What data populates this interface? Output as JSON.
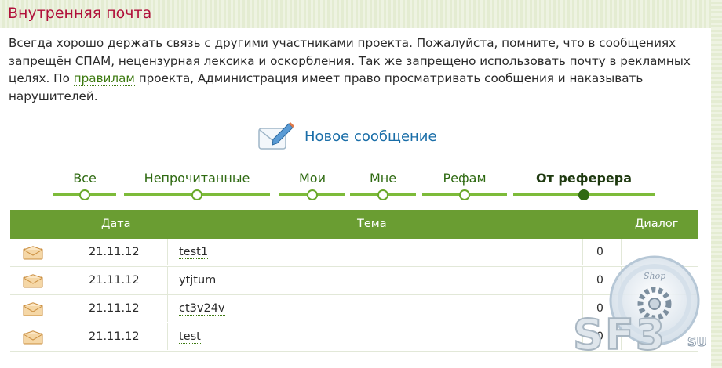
{
  "header": {
    "title": "Внутренняя почта"
  },
  "intro": {
    "text_before_link": "Всегда хорошо держать связь с другими участниками проекта. Пожалуйста, помните, что в сообщениях запрещён СПАМ, нецензурная лексика и оскорбления. Так же запрещено использовать почту в рекламных целях. По ",
    "link_label": "правилам",
    "text_after_link": " проекта, Администрация имеет право просматривать сообщения и наказывать нарушителей."
  },
  "new_message": {
    "label": "Новое сообщение",
    "icon": "envelope-pencil-icon"
  },
  "tabs": [
    {
      "label": "Все",
      "active": false
    },
    {
      "label": "Непрочитанные",
      "active": false
    },
    {
      "label": "Мои",
      "active": false
    },
    {
      "label": "Мне",
      "active": false
    },
    {
      "label": "Рефам",
      "active": false
    },
    {
      "label": "От реферера",
      "active": true
    }
  ],
  "table": {
    "headers": {
      "date": "Дата",
      "subject": "Тема",
      "dialog": "Диалог"
    },
    "rows": [
      {
        "icon": "open-envelope-icon",
        "date": "21.11.12",
        "subject": "test1",
        "count": "0"
      },
      {
        "icon": "open-envelope-icon",
        "date": "21.11.12",
        "subject": "ytjtum",
        "count": "0"
      },
      {
        "icon": "open-envelope-icon",
        "date": "21.11.12",
        "subject": "ct3v24v",
        "count": "0"
      },
      {
        "icon": "open-envelope-icon",
        "date": "21.11.12",
        "subject": "test",
        "count": "0"
      }
    ]
  },
  "watermark": {
    "brand": "SF3",
    "suffix": "SU",
    "badge_text": "Shop"
  },
  "colors": {
    "title": "#b0103a",
    "link": "#1a6ea8",
    "accent_green": "#6a9d32",
    "tab_line": "#7dbb3a"
  }
}
